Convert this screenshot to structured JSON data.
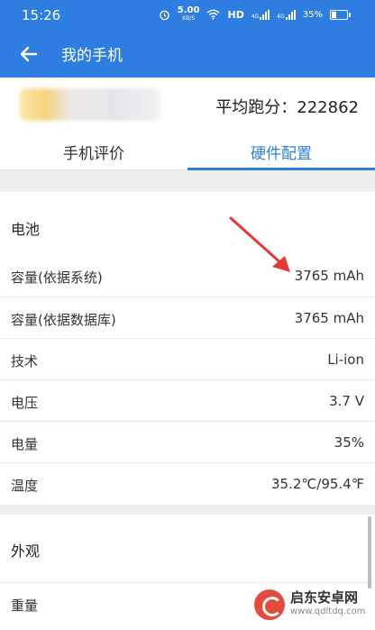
{
  "status_bar": {
    "time": "15:26",
    "net_speed": "5.00",
    "net_unit": "KB/S",
    "hd": "HD",
    "sig1": "4G",
    "sig2": "4G",
    "battery": "35%"
  },
  "app_bar": {
    "title": "我的手机"
  },
  "header": {
    "score": "平均跑分：222862"
  },
  "tabs": [
    {
      "label": "手机评价",
      "active": false
    },
    {
      "label": "硬件配置",
      "active": true
    }
  ],
  "battery_section": {
    "title": "电池",
    "rows": [
      {
        "label": "容量(依据系统)",
        "value": "3765 mAh"
      },
      {
        "label": "容量(依据数据库)",
        "value": "3765 mAh"
      },
      {
        "label": "技术",
        "value": "Li-ion"
      },
      {
        "label": "电压",
        "value": "3.7 V"
      },
      {
        "label": "电量",
        "value": "35%"
      },
      {
        "label": "温度",
        "value": "35.2℃/95.4℉"
      }
    ]
  },
  "appearance_section": {
    "title": "外观",
    "rows": [
      {
        "label": "重量",
        "value": ""
      }
    ]
  },
  "watermark": {
    "line1": "启东安卓网",
    "line2": "www.qdltdq.com"
  },
  "colors": {
    "accent": "#2d7ee0",
    "arrow": "#e53935"
  }
}
